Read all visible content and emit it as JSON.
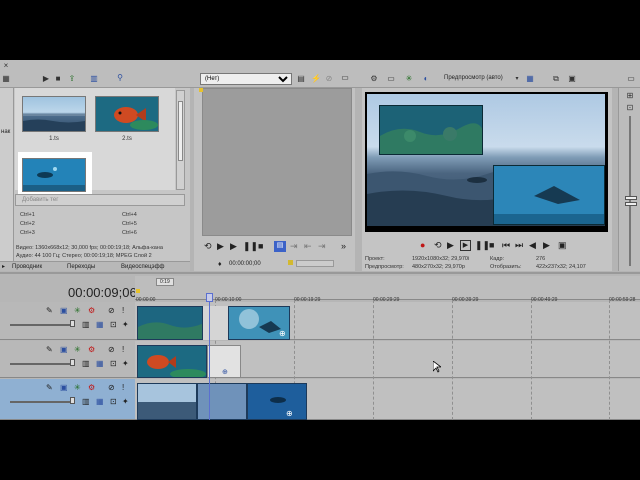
{
  "colors": {
    "app_bg": "#b4b4b4",
    "panel_bg": "#c6c6c6",
    "track_selected": "#8fb0d2",
    "clip_border": "#1d3a5a",
    "cursor_line": "#5a6fd0"
  },
  "media_panel": {
    "left_edge_text": "нак",
    "thumbnails": [
      {
        "label": "1.ts",
        "icon": "sea-horizon"
      },
      {
        "label": "2.ts",
        "icon": "red-fish"
      },
      {
        "label": "",
        "icon": "underwater-diver"
      }
    ],
    "effect_title": "Добавить тег",
    "shortcuts": [
      "Ctrl+1",
      "Ctrl+2",
      "Ctrl+3",
      "Ctrl+4",
      "Ctrl+5",
      "Ctrl+6"
    ],
    "info_video": "Видео: 1360x668x12; 30,000 fps; 00:00:19;18; Альфа-кана",
    "info_audio": "Аудио: 44 100 Гц; Стерео; 00:00:19;18; MPEG Слой 2",
    "tabs": [
      "Проводник",
      "Переходы",
      "Видеоспецэфф"
    ]
  },
  "trimmer": {
    "dropdown_value": "(Нет)",
    "timecode": "00:00:00;00"
  },
  "preview": {
    "mode_label": "Предпросмотр (авто)",
    "info": {
      "project_label": "Проект:",
      "project_value": "1920x1080x32; 29,970i",
      "preview_label": "Предпросмотр:",
      "preview_value": "480x270x32; 29,970p",
      "frame_label": "Кадр:",
      "frame_value": "276",
      "display_label": "Отобразить:",
      "display_value": "422x237x32; 24,107"
    }
  },
  "timeline": {
    "current_time": "00:00:09;06",
    "cursor_badge": "0:19",
    "ruler_labels": [
      "00:00:00",
      "00:00:10:00",
      "00:00:19:29",
      "00:00:29:29",
      "00:00:39:29",
      "00:00:49:29",
      "00:00:59:28"
    ]
  }
}
